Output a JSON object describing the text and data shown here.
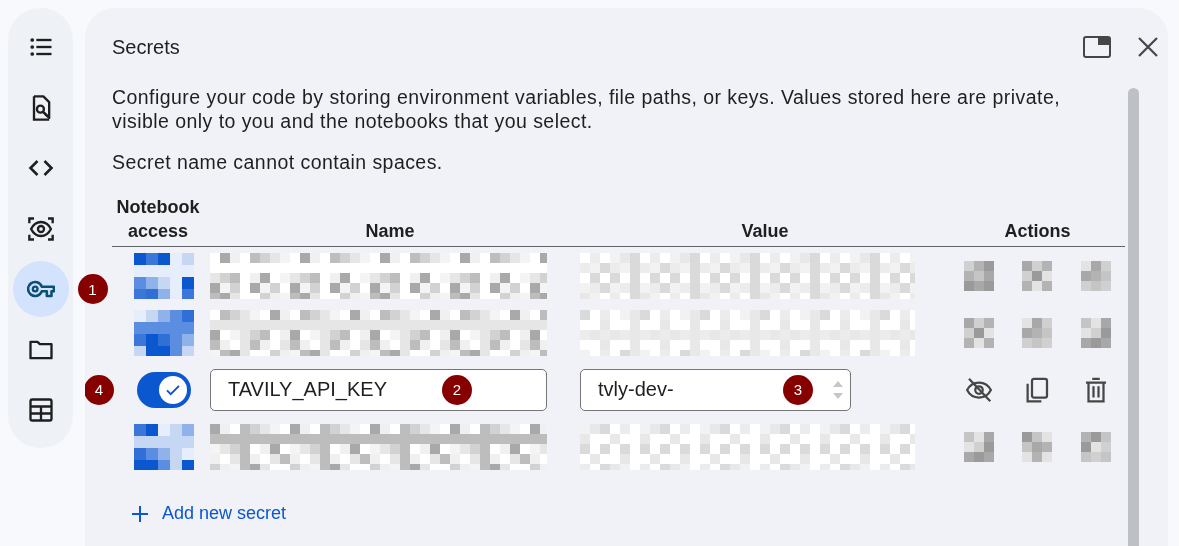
{
  "sidebar": {
    "items": [
      {
        "selected": false
      },
      {
        "selected": false
      },
      {
        "selected": false
      },
      {
        "selected": false
      },
      {
        "selected": true,
        "annotation": "1"
      },
      {
        "selected": false
      },
      {
        "selected": false
      }
    ]
  },
  "panel": {
    "title": "Secrets",
    "description": "Configure your code by storing environment variables, file paths, or keys. Values stored here are private, visible only to you and the notebooks that you select.",
    "note": "Secret name cannot contain spaces."
  },
  "table": {
    "columns": [
      "Notebook access",
      "Name",
      "Value",
      "Actions"
    ],
    "rows": [
      {
        "kind": "pixelated"
      },
      {
        "kind": "pixelated"
      },
      {
        "kind": "secret",
        "access": true,
        "access_annotation": "4",
        "name": "TAVILY_API_KEY",
        "name_annotation": "2",
        "value": "tvly-dev-",
        "value_annotation": "3"
      },
      {
        "kind": "pixelated"
      }
    ]
  },
  "add_button": {
    "label": "Add new secret"
  }
}
